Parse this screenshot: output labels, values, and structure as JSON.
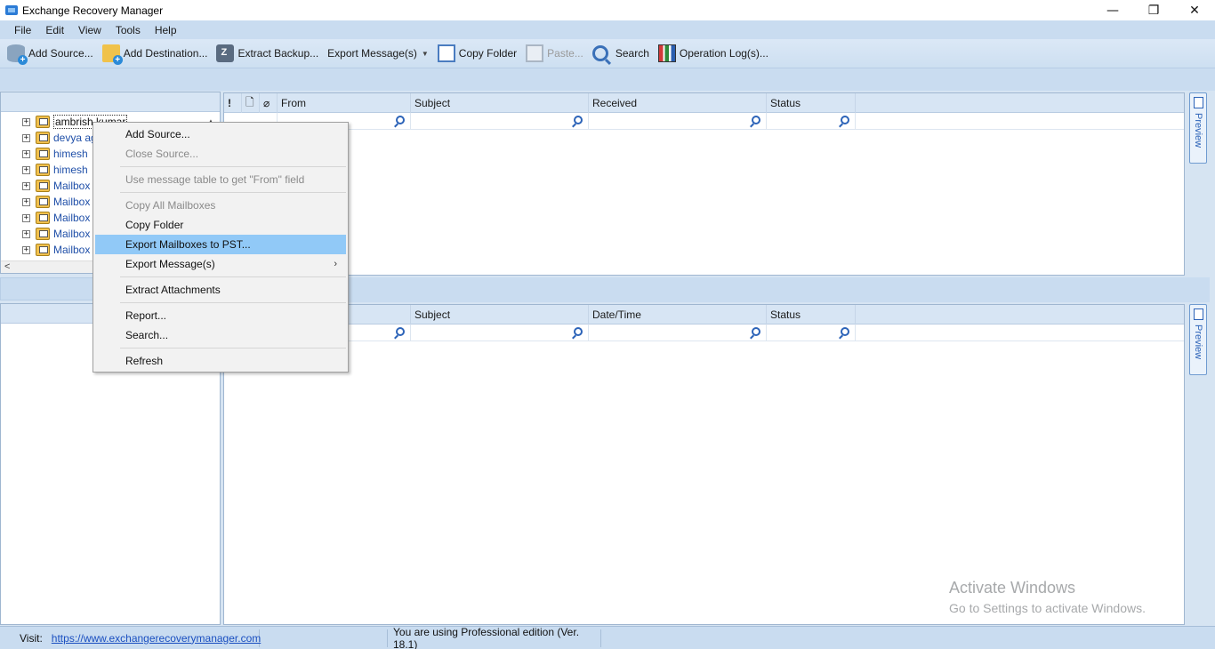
{
  "window": {
    "title": "Exchange Recovery Manager",
    "controls": [
      "—",
      "❐",
      "✕"
    ]
  },
  "menubar": [
    "File",
    "Edit",
    "View",
    "Tools",
    "Help"
  ],
  "toolbar": {
    "add_source": "Add Source...",
    "add_destination": "Add Destination...",
    "extract_backup": "Extract Backup...",
    "export_messages": "Export Message(s)",
    "copy_folder": "Copy Folder",
    "paste": "Paste...",
    "search": "Search",
    "operation_logs": "Operation Log(s)..."
  },
  "tree": {
    "items": [
      {
        "label": "ambrish kumar",
        "selected": true
      },
      {
        "label": "devya ag"
      },
      {
        "label": "himesh"
      },
      {
        "label": "himesh"
      },
      {
        "label": "Mailbox"
      },
      {
        "label": "Mailbox"
      },
      {
        "label": "Mailbox"
      },
      {
        "label": "Mailbox"
      },
      {
        "label": "Mailbox"
      }
    ]
  },
  "top_grid": {
    "icon_cols": [
      "!",
      "🗋",
      "⌀"
    ],
    "columns": [
      "From",
      "Subject",
      "Received",
      "Status"
    ]
  },
  "bottom_grid": {
    "columns": [
      "",
      "Subject",
      "Date/Time",
      "Status"
    ]
  },
  "preview_label": "Preview",
  "context_menu": {
    "items": [
      {
        "label": "Add Source...",
        "enabled": true
      },
      {
        "label": "Close Source...",
        "enabled": false
      },
      {
        "sep": true
      },
      {
        "label": "Use message table to get \"From\" field",
        "enabled": false
      },
      {
        "sep": true
      },
      {
        "label": "Copy All Mailboxes",
        "enabled": false
      },
      {
        "label": "Copy Folder",
        "enabled": true
      },
      {
        "label": "Export Mailboxes to PST...",
        "enabled": true,
        "highlighted": true
      },
      {
        "label": "Export Message(s)",
        "enabled": true,
        "submenu": true
      },
      {
        "sep": true
      },
      {
        "label": "Extract Attachments",
        "enabled": true
      },
      {
        "sep": true
      },
      {
        "label": "Report...",
        "enabled": true
      },
      {
        "label": "Search...",
        "enabled": true
      },
      {
        "sep": true
      },
      {
        "label": "Refresh",
        "enabled": true
      }
    ]
  },
  "watermark": {
    "line1": "Activate Windows",
    "line2": "Go to Settings to activate Windows."
  },
  "statusbar": {
    "visit_label": "Visit:",
    "url": "https://www.exchangerecoverymanager.com",
    "edition": "You are using Professional edition (Ver. 18.1)"
  }
}
